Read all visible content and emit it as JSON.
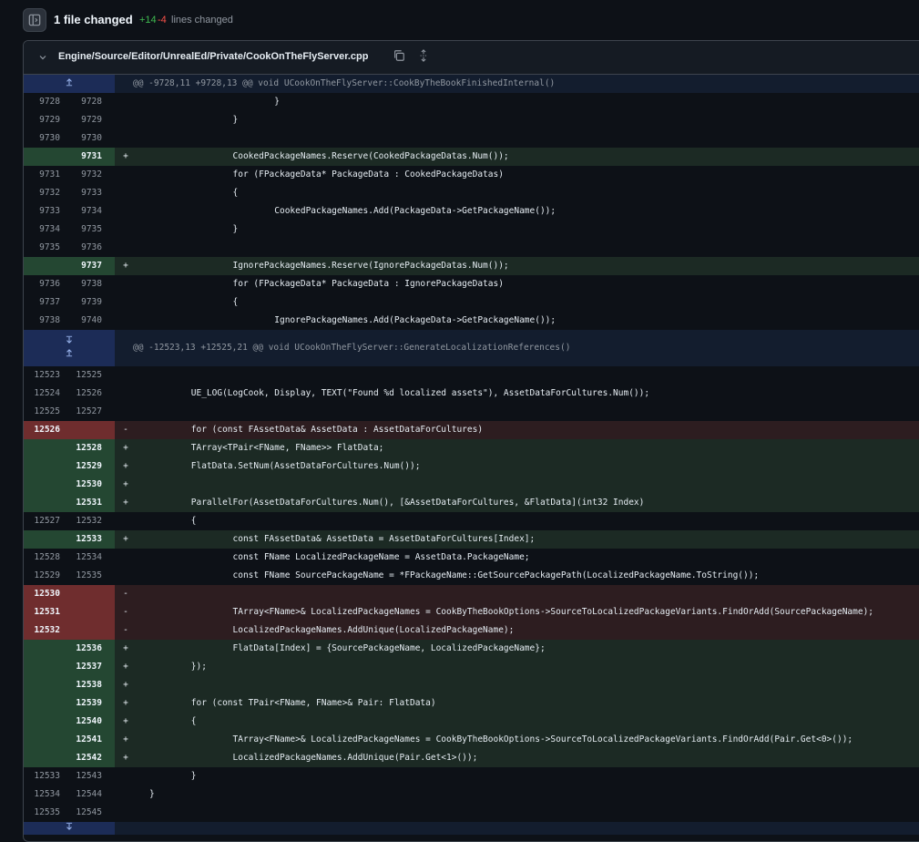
{
  "summary": {
    "title": "1 file changed",
    "additions": "+14",
    "deletions": "-4",
    "lines_label": "lines changed"
  },
  "file": {
    "path": "Engine/Source/Editor/UnrealEd/Private/CookOnTheFlyServer.cpp"
  },
  "rows": [
    {
      "type": "hunk",
      "text": "@@ -9728,11 +9728,13 @@ void UCookOnTheFlyServer::CookByTheBookFinishedInternal()",
      "icons": [
        "expand-up-icon"
      ]
    },
    {
      "type": "ctx",
      "l": "9728",
      "r": "9728",
      "code": "                        }"
    },
    {
      "type": "ctx",
      "l": "9729",
      "r": "9729",
      "code": "                }"
    },
    {
      "type": "ctx",
      "l": "9730",
      "r": "9730",
      "code": ""
    },
    {
      "type": "add",
      "l": "",
      "r": "9731",
      "code": "                CookedPackageNames.Reserve(CookedPackageDatas.Num());"
    },
    {
      "type": "ctx",
      "l": "9731",
      "r": "9732",
      "code": "                for (FPackageData* PackageData : CookedPackageDatas)"
    },
    {
      "type": "ctx",
      "l": "9732",
      "r": "9733",
      "code": "                {"
    },
    {
      "type": "ctx",
      "l": "9733",
      "r": "9734",
      "code": "                        CookedPackageNames.Add(PackageData->GetPackageName());"
    },
    {
      "type": "ctx",
      "l": "9734",
      "r": "9735",
      "code": "                }"
    },
    {
      "type": "ctx",
      "l": "9735",
      "r": "9736",
      "code": ""
    },
    {
      "type": "add",
      "l": "",
      "r": "9737",
      "code": "                IgnorePackageNames.Reserve(IgnorePackageDatas.Num());"
    },
    {
      "type": "ctx",
      "l": "9736",
      "r": "9738",
      "code": "                for (FPackageData* PackageData : IgnorePackageDatas)"
    },
    {
      "type": "ctx",
      "l": "9737",
      "r": "9739",
      "code": "                {"
    },
    {
      "type": "ctx",
      "l": "9738",
      "r": "9740",
      "code": "                        IgnorePackageNames.Add(PackageData->GetPackageName());"
    },
    {
      "type": "hunk2",
      "text": "@@ -12523,13 +12525,21 @@ void UCookOnTheFlyServer::GenerateLocalizationReferences()",
      "icons": [
        "expand-down-icon",
        "expand-up-icon"
      ]
    },
    {
      "type": "ctx",
      "l": "12523",
      "r": "12525",
      "code": ""
    },
    {
      "type": "ctx",
      "l": "12524",
      "r": "12526",
      "code": "        UE_LOG(LogCook, Display, TEXT(\"Found %d localized assets\"), AssetDataForCultures.Num());"
    },
    {
      "type": "ctx",
      "l": "12525",
      "r": "12527",
      "code": ""
    },
    {
      "type": "del",
      "l": "12526",
      "r": "",
      "code": "        for (const FAssetData& AssetData : AssetDataForCultures)"
    },
    {
      "type": "add",
      "l": "",
      "r": "12528",
      "code": "        TArray<TPair<FName, FName>> FlatData;"
    },
    {
      "type": "add",
      "l": "",
      "r": "12529",
      "code": "        FlatData.SetNum(AssetDataForCultures.Num());"
    },
    {
      "type": "add",
      "l": "",
      "r": "12530",
      "code": ""
    },
    {
      "type": "add",
      "l": "",
      "r": "12531",
      "code": "        ParallelFor(AssetDataForCultures.Num(), [&AssetDataForCultures, &FlatData](int32 Index)"
    },
    {
      "type": "ctx",
      "l": "12527",
      "r": "12532",
      "code": "        {"
    },
    {
      "type": "add",
      "l": "",
      "r": "12533",
      "code": "                const FAssetData& AssetData = AssetDataForCultures[Index];"
    },
    {
      "type": "ctx",
      "l": "12528",
      "r": "12534",
      "code": "                const FName LocalizedPackageName = AssetData.PackageName;"
    },
    {
      "type": "ctx",
      "l": "12529",
      "r": "12535",
      "code": "                const FName SourcePackageName = *FPackageName::GetSourcePackagePath(LocalizedPackageName.ToString());"
    },
    {
      "type": "del",
      "l": "12530",
      "r": "",
      "code": ""
    },
    {
      "type": "del",
      "l": "12531",
      "r": "",
      "code": "                TArray<FName>& LocalizedPackageNames = CookByTheBookOptions->SourceToLocalizedPackageVariants.FindOrAdd(SourcePackageName);"
    },
    {
      "type": "del",
      "l": "12532",
      "r": "",
      "code": "                LocalizedPackageNames.AddUnique(LocalizedPackageName);"
    },
    {
      "type": "add",
      "l": "",
      "r": "12536",
      "code": "                FlatData[Index] = {SourcePackageName, LocalizedPackageName};"
    },
    {
      "type": "add",
      "l": "",
      "r": "12537",
      "code": "        });"
    },
    {
      "type": "add",
      "l": "",
      "r": "12538",
      "code": ""
    },
    {
      "type": "add",
      "l": "",
      "r": "12539",
      "code": "        for (const TPair<FName, FName>& Pair: FlatData)"
    },
    {
      "type": "add",
      "l": "",
      "r": "12540",
      "code": "        {"
    },
    {
      "type": "add",
      "l": "",
      "r": "12541",
      "code": "                TArray<FName>& LocalizedPackageNames = CookByTheBookOptions->SourceToLocalizedPackageVariants.FindOrAdd(Pair.Get<0>());"
    },
    {
      "type": "add",
      "l": "",
      "r": "12542",
      "code": "                LocalizedPackageNames.AddUnique(Pair.Get<1>());"
    },
    {
      "type": "ctx",
      "l": "12533",
      "r": "12543",
      "code": "        }"
    },
    {
      "type": "ctx",
      "l": "12534",
      "r": "12544",
      "code": "}"
    },
    {
      "type": "ctx",
      "l": "12535",
      "r": "12545",
      "code": ""
    },
    {
      "type": "hunk-end",
      "text": "",
      "icons": [
        "expand-down-icon"
      ]
    }
  ],
  "colors": {
    "add_gutter": "#244732",
    "add_bg": "#1c2a24",
    "del_gutter": "#6f2d2e",
    "del_bg": "#2d1d20",
    "hunk_gutter": "#1c2c57",
    "hunk_bg": "#131d2e"
  }
}
